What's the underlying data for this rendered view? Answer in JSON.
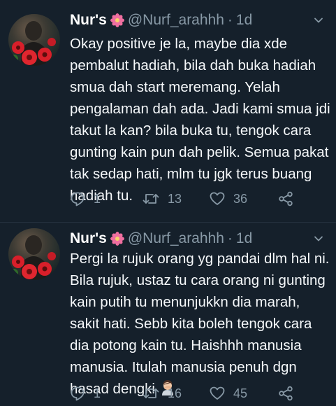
{
  "tweets": [
    {
      "name": "Nur's",
      "handle": "@Nurf_arahhh",
      "separator": "·",
      "time": "1d",
      "text": "Okay positive je la, maybe dia xde\npembalut hadiah, bila dah buka hadiah\nsmua dah start meremang. Yelah\npengalaman dah ada. Jadi kami smua jdi\ntakut la kan? bila buka tu, tengok cara\ngunting kain pun dah pelik. Semua pakat\ntak sedap hati, mlm tu jgk terus buang\nhadiah tu.",
      "reply_count": "1",
      "retweet_count": "13",
      "like_count": "36"
    },
    {
      "name": "Nur's",
      "handle": "@Nurf_arahhh",
      "separator": "·",
      "time": "1d",
      "text": "Pergi la rujuk orang yg pandai dlm hal ni.\nBila rujuk, ustaz tu cara orang ni gunting\nkain putih tu menunjukkn dia marah,\nsakit hati. Sebb kita boleh tengok cara\ndia potong kain tu. Haishhh manusia\nmanusia. Itulah manusia penuh dgn\nhasad dengki",
      "reply_count": "1",
      "retweet_count": "16",
      "like_count": "45"
    }
  ],
  "colors": {
    "background": "#15202b",
    "secondary_text": "#8899a6",
    "primary_text": "#f5f8fa",
    "flower_emoji": "#f06fa0"
  },
  "icons": [
    "flower-emoji-icon",
    "chevron-down-icon",
    "reply-icon",
    "retweet-icon",
    "like-icon",
    "share-icon",
    "facepalm-emoji-icon"
  ]
}
